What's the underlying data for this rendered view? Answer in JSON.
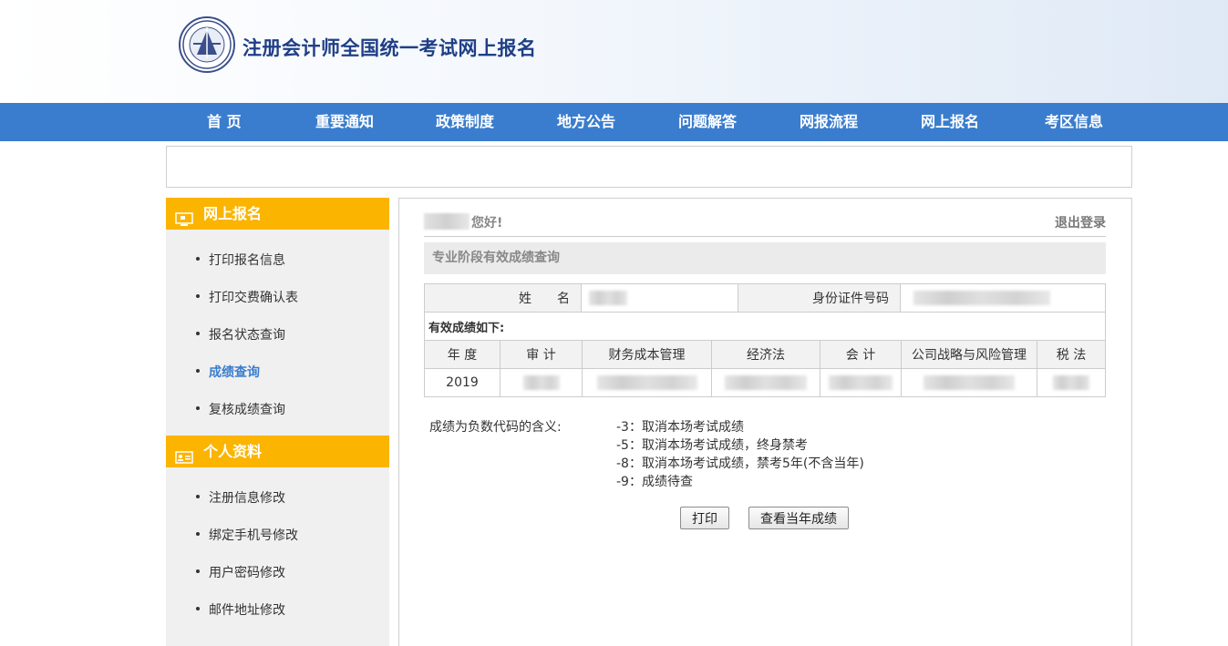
{
  "header": {
    "site_title": "注册会计师全国统一考试网上报名"
  },
  "nav": [
    "首 页",
    "重要通知",
    "政策制度",
    "地方公告",
    "问题解答",
    "网报流程",
    "网上报名",
    "考区信息"
  ],
  "sidebar": {
    "section1": {
      "title": "网上报名",
      "icon": "monitor-icon",
      "items": [
        "打印报名信息",
        "打印交费确认表",
        "报名状态查询",
        "成绩查询",
        "复核成绩查询"
      ]
    },
    "section2": {
      "title": "个人资料",
      "icon": "id-card-icon",
      "items": [
        "注册信息修改",
        "绑定手机号修改",
        "用户密码修改",
        "邮件地址修改"
      ]
    },
    "active_item": "成绩查询",
    "active_color": "#3a7dce"
  },
  "main": {
    "greeting": "您好!",
    "logout": "退出登录",
    "section_title": "专业阶段有效成绩查询",
    "info": {
      "name_label": "姓　　名",
      "id_label": "身份证件号码"
    },
    "scores_caption": "有效成绩如下:",
    "score_headers": [
      "年 度",
      "审 计",
      "财务成本管理",
      "经济法",
      "会 计",
      "公司战略与风险管理",
      "税 法"
    ],
    "score_row": {
      "year": "2019"
    },
    "legend_label": "成绩为负数代码的含义:",
    "legend_lines": [
      "-3：取消本场考试成绩",
      "-5：取消本场考试成绩，终身禁考",
      "-8：取消本场考试成绩，禁考5年(不含当年)",
      "-9：成绩待查"
    ],
    "print_button": "打印",
    "current_year_button": "查看当年成绩"
  },
  "colors": {
    "nav_bg": "#3a7dce",
    "sidebar_header": "#fbb400",
    "title": "#1f3f86"
  }
}
